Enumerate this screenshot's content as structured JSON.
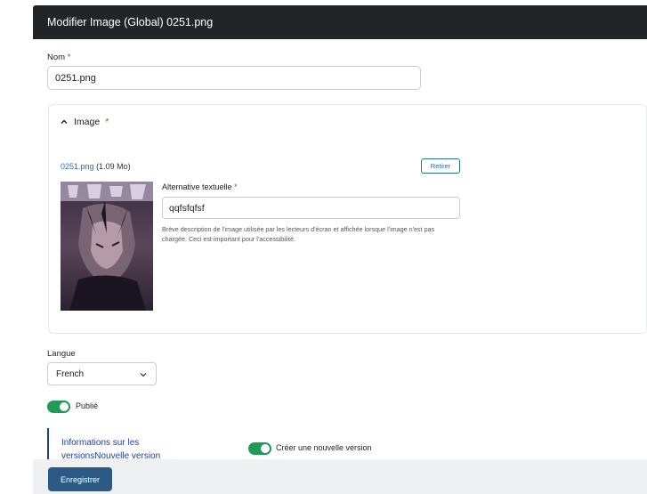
{
  "modal": {
    "title": "Modifier Image (Global) 0251.png"
  },
  "nom": {
    "label": "Nom",
    "required_mark": "*",
    "value": "0251.png"
  },
  "image_section": {
    "legend": "Image",
    "required_mark": "*",
    "file_name": "0251.png",
    "file_size": "(1.09 Mo)",
    "remove_label": "Retirer",
    "alt_label": "Alternative textuelle",
    "alt_required_mark": "*",
    "alt_value": "qqfsfqfsf",
    "alt_help": "Brève description de l'image utilisée par les lecteurs d'écran et affichée lorsque l'image n'est pas chargée. Ceci est important pour l'accessibilité."
  },
  "langue": {
    "label": "Langue",
    "selected": "French"
  },
  "publie": {
    "label": "Publié",
    "on": true
  },
  "versions": {
    "title": "Informations sur les versionsNouvelle version",
    "toggle_label": "Créer une nouvelle version",
    "on": true
  },
  "footer": {
    "save_label": "Enregistrer"
  },
  "colors": {
    "header_bg": "#232427",
    "accent_blue": "#2a6cb0",
    "toggle_green": "#1f9b57",
    "save_bg": "#2b5b85",
    "version_accent": "#1f3fa0"
  },
  "icons": {
    "collapse": "chevron-up-icon",
    "select": "chevron-down-icon"
  }
}
